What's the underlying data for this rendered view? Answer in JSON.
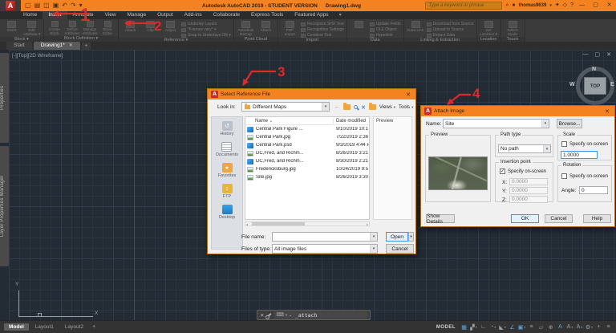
{
  "ui": {
    "caret": "▾",
    "close": "✕",
    "sort_asc": "▴",
    "minimize": "—",
    "restore": "▢",
    "check": "✓"
  },
  "titlebar": {
    "logo": "A",
    "qat": [
      {
        "name": "new-file-icon",
        "glyph": "▢"
      },
      {
        "name": "open-file-icon",
        "glyph": "▤"
      },
      {
        "name": "save-icon",
        "glyph": "◫"
      },
      {
        "name": "plot-icon",
        "glyph": "▣"
      },
      {
        "name": "undo-icon",
        "glyph": "↶"
      },
      {
        "name": "redo-icon",
        "glyph": "↷"
      },
      {
        "name": "qat-dropdown-icon",
        "glyph": "▾"
      }
    ],
    "app_title": "Autodesk AutoCAD 2019 - STUDENT VERSION",
    "doc_title": "Drawing1.dwg",
    "search_placeholder": "Type a keyword or phrase",
    "user": "thomas9639",
    "help_icon": "?"
  },
  "ribbon": {
    "tabs": [
      "Home",
      "Insert",
      "Annotate",
      "View",
      "Manage",
      "Output",
      "Add-ins",
      "Collaborate",
      "Express Tools",
      "Featured Apps"
    ],
    "active_tab": "Insert",
    "overflow_icon": "▾",
    "panels": [
      {
        "label": "Block",
        "caret": true,
        "large": [
          {
            "label": "Insert"
          },
          {
            "label": "Edit Attribute",
            "caret": true
          }
        ]
      },
      {
        "label": "Block Definition",
        "caret": true,
        "medium": [
          {
            "label": "Create Block"
          },
          {
            "label": "Define Attributes"
          },
          {
            "label": "Manage Attributes"
          },
          {
            "label": "Block Editor"
          }
        ]
      },
      {
        "label": "Reference",
        "caret": true,
        "large": [
          {
            "label": "Attach"
          },
          {
            "label": "Clip"
          },
          {
            "label": "Adjust"
          }
        ],
        "stack": [
          {
            "label": "Underlay Layers"
          },
          {
            "label": "*Frames vary*",
            "caret": true
          },
          {
            "label": "Snap to Underlays ON",
            "caret": true
          }
        ]
      },
      {
        "label": "Point Cloud",
        "large": [
          {
            "label": "Autodesk ReCap"
          },
          {
            "label": "Attach"
          }
        ]
      },
      {
        "label": "Import",
        "large": [
          {
            "label": "PDF Import"
          }
        ],
        "stack": [
          {
            "label": "Recognize SHX Text"
          },
          {
            "label": "Recognition Settings"
          },
          {
            "label": "Combine Text"
          }
        ]
      },
      {
        "label": "Data",
        "large": [
          {
            "label": "",
            "icon": "field-icon"
          }
        ],
        "stack": [
          {
            "label": "Update Fields"
          },
          {
            "label": "OLE Object"
          },
          {
            "label": "Hyperlink"
          }
        ]
      },
      {
        "label": "Linking & Extraction",
        "large": [
          {
            "label": "Data Link"
          }
        ],
        "stack": [
          {
            "label": "Download from Source"
          },
          {
            "label": "Upload to Source"
          },
          {
            "label": "Extract Data"
          }
        ]
      },
      {
        "label": "Location",
        "large": [
          {
            "label": "Set Location",
            "caret": true
          }
        ]
      },
      {
        "label": "Touch",
        "large": [
          {
            "label": "Select Mode"
          }
        ]
      }
    ]
  },
  "file_tabs": {
    "tabs": [
      {
        "label": "Start",
        "active": false
      },
      {
        "label": "Drawing1*",
        "active": true
      }
    ],
    "new_tab": "+"
  },
  "canvas": {
    "viewport_label": "[-][Top][2D Wireframe]",
    "viewcube": {
      "north": "N",
      "west": "W",
      "east": "E",
      "face": "TOP"
    },
    "ucs": {
      "x_label": "X",
      "y_label": "Y"
    }
  },
  "side_panels": [
    {
      "label": "Properties"
    },
    {
      "label": "Layer Properties Manager"
    }
  ],
  "command_line": {
    "command_text": "- _attach"
  },
  "bottom_bar": {
    "layout_tabs": [
      {
        "label": "Model",
        "active": true
      },
      {
        "label": "Layout1",
        "active": false
      },
      {
        "label": "Layout2",
        "active": false
      }
    ],
    "new_layout_icon": "+",
    "model_badge": "MODEL",
    "status_active_color": "#5CA7DF",
    "status_icons": [
      {
        "name": "grid-display-icon",
        "glyph": "▦",
        "active": true,
        "caret": false
      },
      {
        "name": "snap-mode-icon",
        "glyph": "▞",
        "active": false,
        "caret": true
      },
      {
        "name": "ortho-mode-icon",
        "glyph": "∟",
        "active": false,
        "caret": false
      },
      {
        "name": "polar-tracking-icon",
        "glyph": "◔",
        "active": false,
        "caret": true
      },
      {
        "name": "isometric-drafting-icon",
        "glyph": "◣",
        "active": false,
        "caret": true
      },
      {
        "name": "osnap-tracking-icon",
        "glyph": "∠",
        "active": true,
        "caret": false
      },
      {
        "name": "object-snap-icon",
        "glyph": "▣",
        "active": true,
        "caret": true
      },
      {
        "name": "lineweight-icon",
        "glyph": "≡",
        "active": false,
        "caret": false
      },
      {
        "name": "transparency-icon",
        "glyph": "▱",
        "active": false,
        "caret": false
      },
      {
        "name": "selection-cycling-icon",
        "glyph": "⊕",
        "active": false,
        "caret": false
      },
      {
        "name": "annotation-visibility-icon",
        "glyph": "A",
        "active": true,
        "caret": false
      },
      {
        "name": "annotation-autoscale-icon",
        "glyph": "A",
        "active": false,
        "caret": true
      },
      {
        "name": "annotation-scale-icon",
        "glyph": "A",
        "active": false,
        "caret": true
      },
      {
        "name": "workspace-icon",
        "glyph": "⚙",
        "active": false,
        "caret": true
      },
      {
        "name": "annotation-monitor-icon",
        "glyph": "+",
        "active": false,
        "caret": false
      },
      {
        "name": "customization-icon",
        "glyph": "≡",
        "active": false,
        "caret": false
      }
    ]
  },
  "select_reference_dialog": {
    "title": "Select Reference File",
    "look_in_label": "Look in:",
    "look_in_value": "Different Maps",
    "views_label": "Views",
    "tools_label": "Tools",
    "columns": [
      "Name",
      "Date modified"
    ],
    "files": [
      {
        "name": "Central Park Figure ...",
        "date": "9/10/2019 10:1",
        "type": "psd"
      },
      {
        "name": "Central Park.jpg",
        "date": "7/22/2019 2:36",
        "type": "jpg"
      },
      {
        "name": "Central Park.psd",
        "date": "9/3/2019 4:44 P",
        "type": "psd"
      },
      {
        "name": "DC,Fred, and Richm...",
        "date": "8/26/2019 3:21",
        "type": "jpg"
      },
      {
        "name": "DC,Fred, and Richm...",
        "date": "8/30/2019 2:21",
        "type": "psd"
      },
      {
        "name": "Fredericksburg.jpg",
        "date": "10/24/2019 9:5",
        "type": "jpg"
      },
      {
        "name": "Site.jpg",
        "date": "8/26/2019 3:30",
        "type": "jpg"
      }
    ],
    "places": [
      {
        "label": "History",
        "icon": "history-icon",
        "glyph": "↺"
      },
      {
        "label": "Documents",
        "icon": "documents-icon",
        "glyph": ""
      },
      {
        "label": "Favorites",
        "icon": "favorites-icon",
        "glyph": "★"
      },
      {
        "label": "FTP",
        "icon": "ftp-icon",
        "glyph": "↕"
      },
      {
        "label": "Desktop",
        "icon": "desktop-icon",
        "glyph": ""
      }
    ],
    "preview_label": "Preview",
    "file_name_label": "File name:",
    "file_name_value": "",
    "files_of_type_label": "Files of type:",
    "files_of_type_value": "All image files",
    "open_label": "Open",
    "cancel_label": "Cancel"
  },
  "attach_image_dialog": {
    "title": "Attach Image",
    "name_label": "Name:",
    "name_value": "Site",
    "browse_label": "Browse...",
    "preview_label": "Preview",
    "path_type_label": "Path type",
    "path_type_value": "No path",
    "insertion_point_label": "Insertion point",
    "specify_on_screen_label": "Specify on-screen",
    "x_label": "X:",
    "x_value": "0.0000",
    "y_label": "Y:",
    "y_value": "0.0000",
    "z_label": "Z:",
    "z_value": "0.0000",
    "scale_label": "Scale",
    "scale_value": "1.0000",
    "rotation_label": "Rotation",
    "angle_label": "Angle:",
    "angle_value": "0",
    "show_details_label": "Show Details",
    "ok_label": "OK",
    "cancel_label": "Cancel",
    "help_label": "Help"
  },
  "annotations": {
    "color": "#DD2B2B",
    "items": [
      {
        "label": "1"
      },
      {
        "label": "2"
      },
      {
        "label": "3"
      },
      {
        "label": "4"
      }
    ]
  }
}
